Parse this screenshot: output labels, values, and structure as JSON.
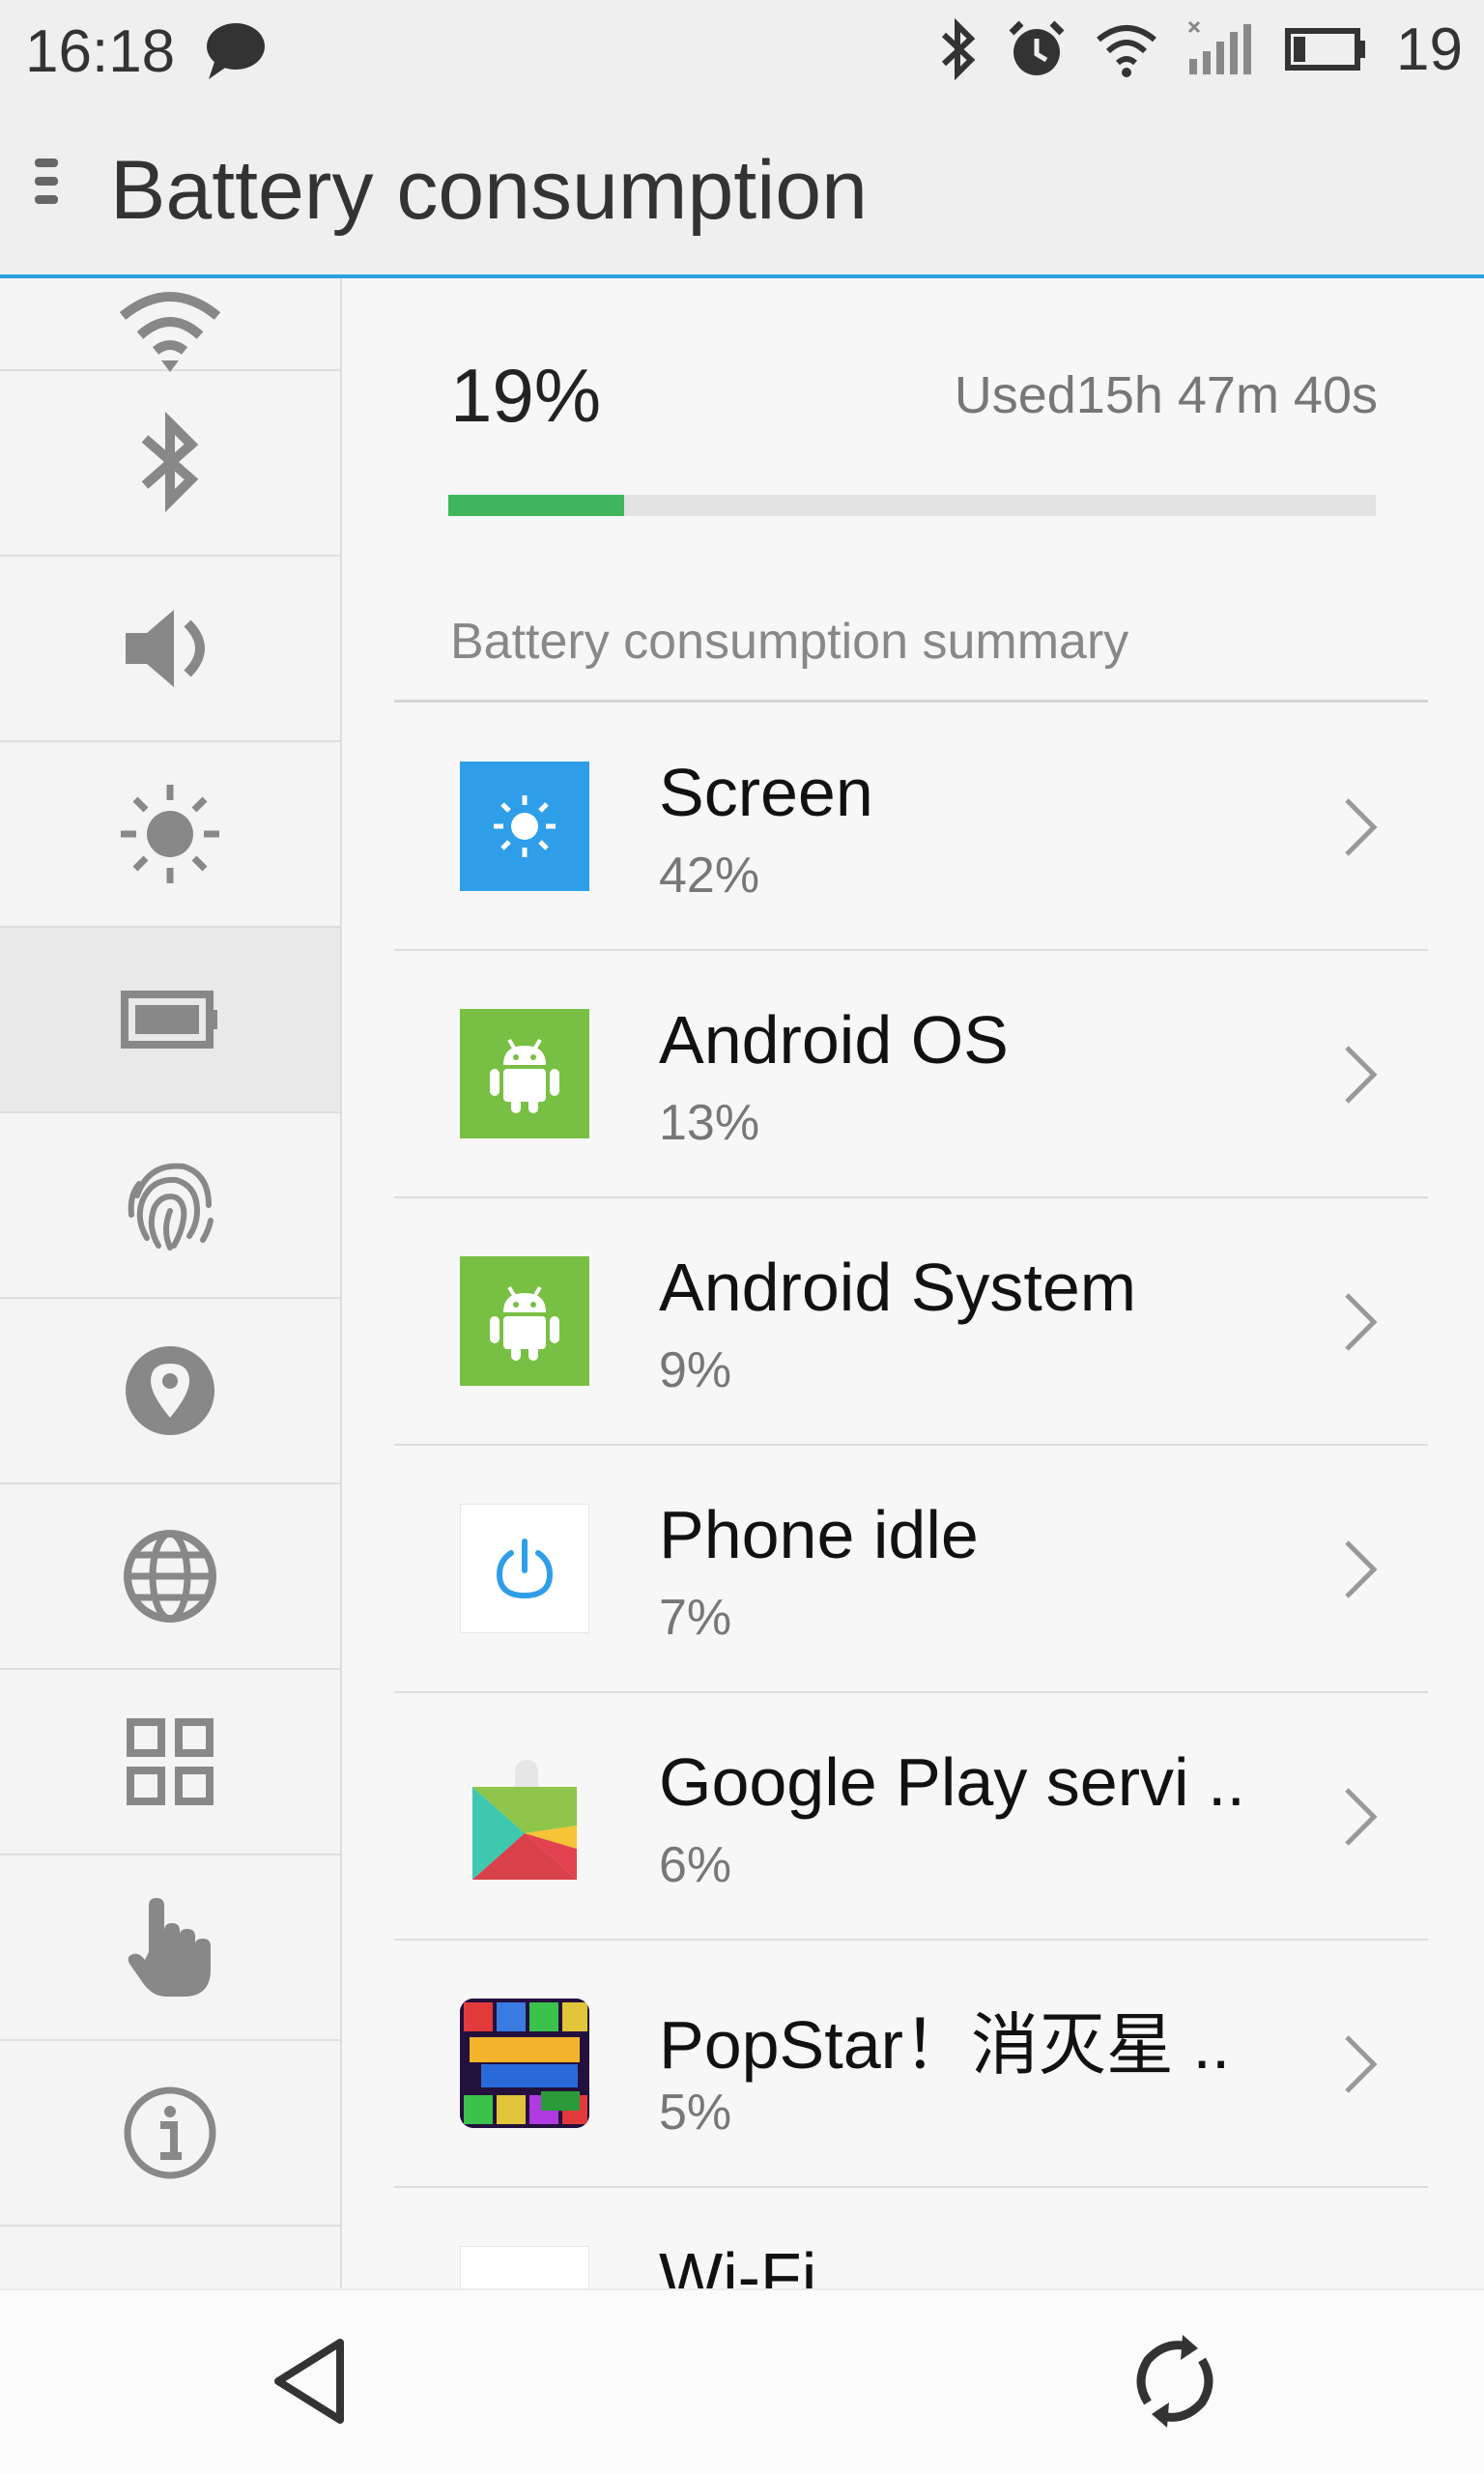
{
  "status_bar": {
    "time": "16:18",
    "battery_level": "19",
    "icons": [
      "chat-icon",
      "bluetooth-icon",
      "alarm-icon",
      "wifi-icon",
      "cell-signal-icon",
      "battery-icon"
    ]
  },
  "toolbar": {
    "title": "Battery consumption",
    "menu_icon": "menu-icon"
  },
  "sidebar": {
    "items": [
      {
        "icon": "wifi-icon",
        "active": false
      },
      {
        "icon": "bluetooth-icon",
        "active": false
      },
      {
        "icon": "volume-icon",
        "active": false
      },
      {
        "icon": "brightness-icon",
        "active": false
      },
      {
        "icon": "battery-icon",
        "active": true
      },
      {
        "icon": "fingerprint-icon",
        "active": false
      },
      {
        "icon": "location-icon",
        "active": false
      },
      {
        "icon": "globe-icon",
        "active": false
      },
      {
        "icon": "apps-grid-icon",
        "active": false
      },
      {
        "icon": "hand-gesture-icon",
        "active": false
      },
      {
        "icon": "info-icon",
        "active": false
      }
    ]
  },
  "battery": {
    "percent": "19%",
    "level": 0.19,
    "used": "Used15h 47m 40s"
  },
  "summary": {
    "title": "Battery consumption summary",
    "items": [
      {
        "name": "Screen",
        "percent": "42%",
        "icon": "screen-brightness-icon"
      },
      {
        "name": "Android OS",
        "percent": "13%",
        "icon": "android-icon"
      },
      {
        "name": "Android System",
        "percent": "9%",
        "icon": "android-icon"
      },
      {
        "name": "Phone idle",
        "percent": "7%",
        "icon": "power-icon"
      },
      {
        "name": "Google Play servi ..",
        "percent": "6%",
        "icon": "google-play-services-icon"
      },
      {
        "name": "PopStar！消灭星 ..",
        "percent": "5%",
        "icon": "popstar-app-icon"
      },
      {
        "name": "Wi-Fi",
        "percent": "",
        "icon": "wifi-app-icon"
      }
    ]
  },
  "navigation": {
    "back": "back-icon",
    "refresh": "refresh-icon"
  },
  "colors": {
    "accent": "#29a1e0",
    "progress": "#41b55d",
    "android": "#78c043",
    "screen_icon": "#2e9ee8"
  }
}
